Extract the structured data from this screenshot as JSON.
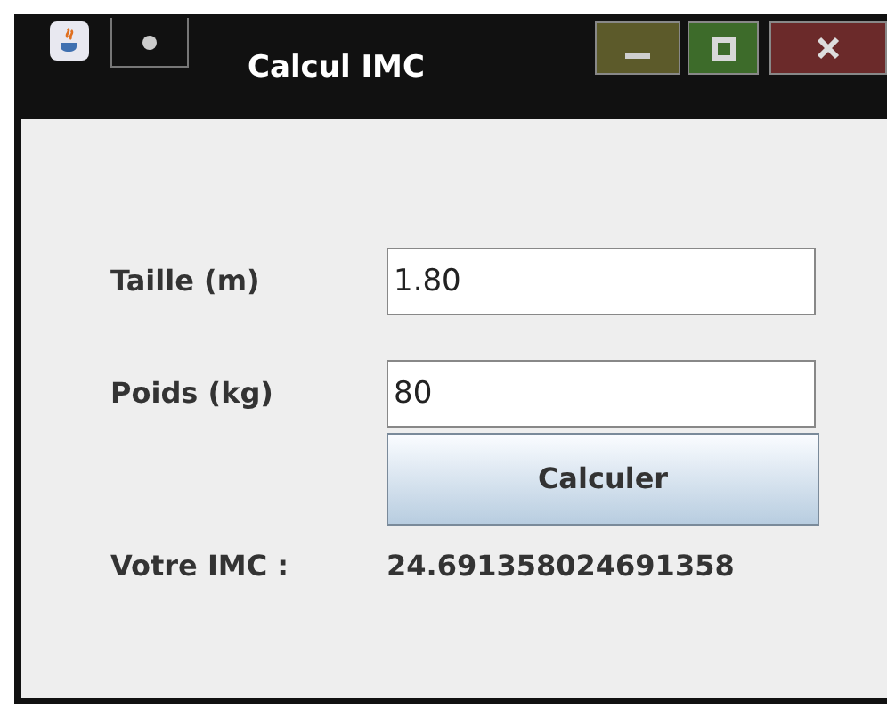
{
  "window": {
    "title": "Calcul IMC"
  },
  "fields": [
    {
      "label": "Taille (m)",
      "value": "1.80"
    },
    {
      "label": "Poids (kg)",
      "value": "80"
    }
  ],
  "button": "Calculer",
  "result": {
    "label": "Votre IMC :",
    "value": "24.691358024691358"
  }
}
